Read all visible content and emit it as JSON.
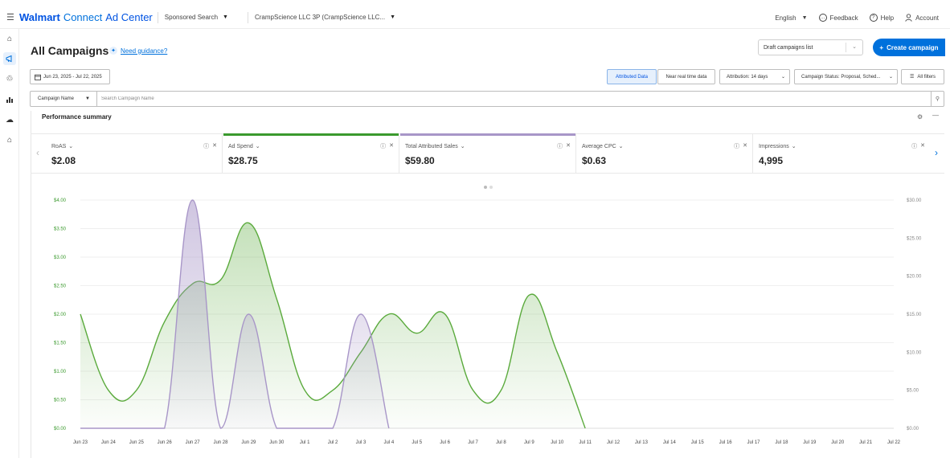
{
  "topbar": {
    "brand_walmart": "Walmart",
    "brand_connect": "Connect",
    "brand_adcenter": "Ad Center",
    "ad_type": "Sponsored Search",
    "account": "CrampScience LLC 3P (CrampScience LLC...",
    "language": "English",
    "feedback": "Feedback",
    "help": "Help",
    "account_menu": "Account"
  },
  "sidebar": {
    "items": [
      {
        "icon": "home-icon",
        "active": false
      },
      {
        "icon": "campaigns-icon",
        "active": true
      },
      {
        "icon": "recycle-icon",
        "active": false
      },
      {
        "icon": "reports-icon",
        "active": false
      },
      {
        "icon": "upload-icon",
        "active": false
      },
      {
        "icon": "store-icon",
        "active": false
      }
    ]
  },
  "header": {
    "title": "All Campaigns",
    "guidance": "Need guidance?",
    "draft_select": "Draft campaigns list",
    "create_button": "Create campaign"
  },
  "filters": {
    "date_range": "Jun 23, 2025 - Jul 22, 2025",
    "attributed": "Attributed Data",
    "near_real_time": "Near real time data",
    "attribution": "Attribution: 14 days",
    "status": "Campaign Status: Proposal, Sched...",
    "all_filters": "All filters"
  },
  "search": {
    "field": "Campaign Name",
    "placeholder": "Search Campaign Name"
  },
  "performance": {
    "title": "Performance summary",
    "kpis": [
      {
        "label": "RoAS",
        "value": "$2.08",
        "bar_color": ""
      },
      {
        "label": "Ad Spend",
        "value": "$28.75",
        "bar_color": "#3b9a2e"
      },
      {
        "label": "Total Attributed Sales",
        "value": "$59.80",
        "bar_color": "#a896c8"
      },
      {
        "label": "Average CPC",
        "value": "$0.63",
        "bar_color": ""
      },
      {
        "label": "Impressions",
        "value": "4,995",
        "bar_color": ""
      }
    ]
  },
  "chart_data": {
    "type": "area",
    "x": [
      "Jun 23",
      "Jun 24",
      "Jun 25",
      "Jun 26",
      "Jun 27",
      "Jun 28",
      "Jun 29",
      "Jun 30",
      "Jul 1",
      "Jul 2",
      "Jul 3",
      "Jul 4",
      "Jul 5",
      "Jul 6",
      "Jul 7",
      "Jul 8",
      "Jul 9",
      "Jul 10",
      "Jul 11",
      "Jul 12",
      "Jul 13",
      "Jul 14",
      "Jul 15",
      "Jul 16",
      "Jul 17",
      "Jul 18",
      "Jul 19",
      "Jul 20",
      "Jul 21",
      "Jul 22"
    ],
    "left_axis": {
      "ticks": [
        "$0.00",
        "$0.50",
        "$1.00",
        "$1.50",
        "$2.00",
        "$2.50",
        "$3.00",
        "$3.50",
        "$4.00"
      ],
      "range": [
        0,
        4
      ]
    },
    "right_axis": {
      "ticks": [
        "$0.00",
        "$5.00",
        "$10.00",
        "$15.00",
        "$20.00",
        "$25.00",
        "$30.00"
      ],
      "range": [
        0,
        30
      ]
    },
    "series": [
      {
        "color": "#5aaa3c",
        "axis": "right",
        "values": [
          15,
          5,
          5,
          14,
          19,
          19.5,
          27,
          17,
          5,
          5,
          10,
          15,
          12.5,
          15,
          5,
          5,
          17.5,
          10,
          0,
          null,
          null,
          null,
          null,
          null,
          null,
          null,
          null,
          null,
          null,
          null
        ]
      },
      {
        "color": "#a896c8",
        "axis": "left",
        "values": [
          0,
          0,
          0,
          0,
          4.0,
          0,
          2.0,
          0,
          0,
          0,
          2.0,
          0,
          null,
          null,
          null,
          null,
          null,
          null,
          null,
          null,
          null,
          null,
          null,
          null,
          null,
          null,
          null,
          null,
          null,
          null
        ]
      }
    ],
    "grid": true
  }
}
